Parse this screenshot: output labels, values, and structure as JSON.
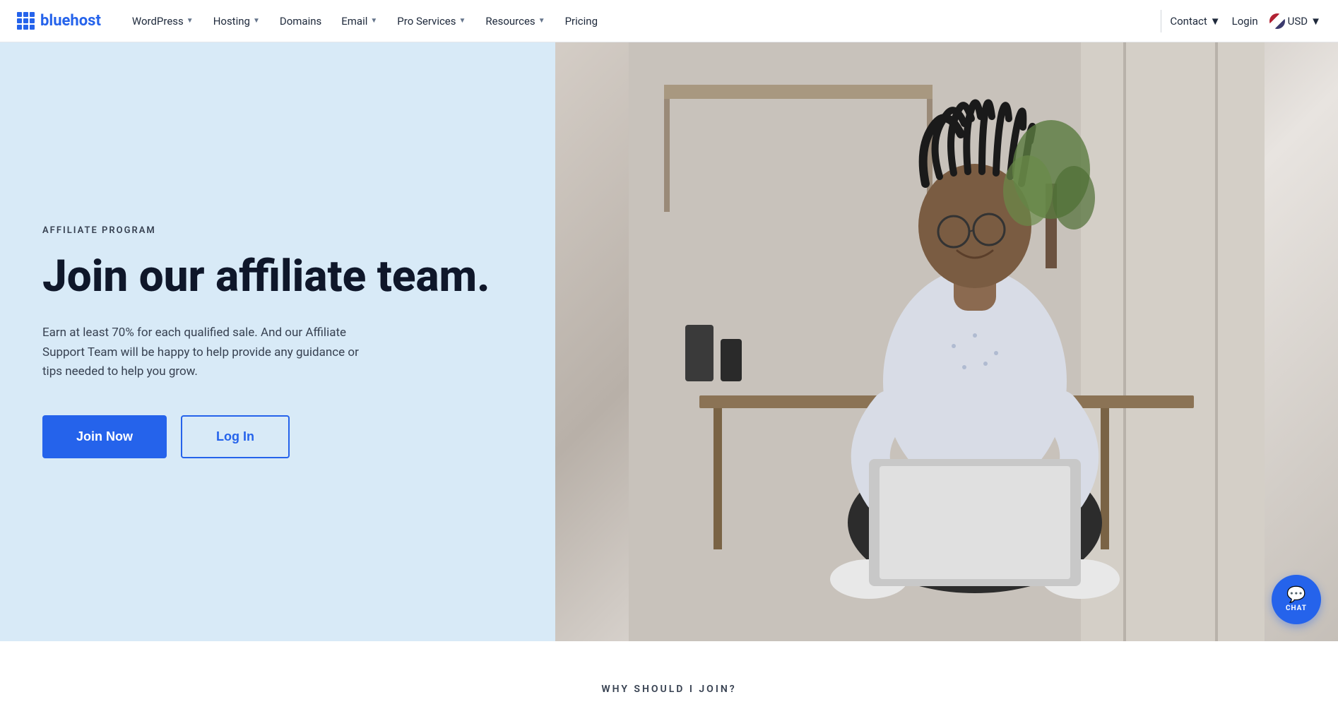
{
  "brand": {
    "name": "bluehost",
    "logo_alt": "Bluehost logo"
  },
  "navbar": {
    "links": [
      {
        "label": "WordPress",
        "has_dropdown": true
      },
      {
        "label": "Hosting",
        "has_dropdown": true
      },
      {
        "label": "Domains",
        "has_dropdown": false
      },
      {
        "label": "Email",
        "has_dropdown": true
      },
      {
        "label": "Pro Services",
        "has_dropdown": true
      },
      {
        "label": "Resources",
        "has_dropdown": true
      },
      {
        "label": "Pricing",
        "has_dropdown": false
      }
    ],
    "contact_label": "Contact",
    "login_label": "Login",
    "currency_label": "USD"
  },
  "hero": {
    "tag": "AFFILIATE PROGRAM",
    "title": "Join our affiliate team.",
    "description": "Earn at least 70% for each qualified sale. And our Affiliate Support Team will be happy to help provide any guidance or tips needed to help you grow.",
    "join_button": "Join Now",
    "login_button": "Log In"
  },
  "why_section": {
    "title": "WHY SHOULD I JOIN?"
  },
  "chat": {
    "label": "CHAT"
  }
}
